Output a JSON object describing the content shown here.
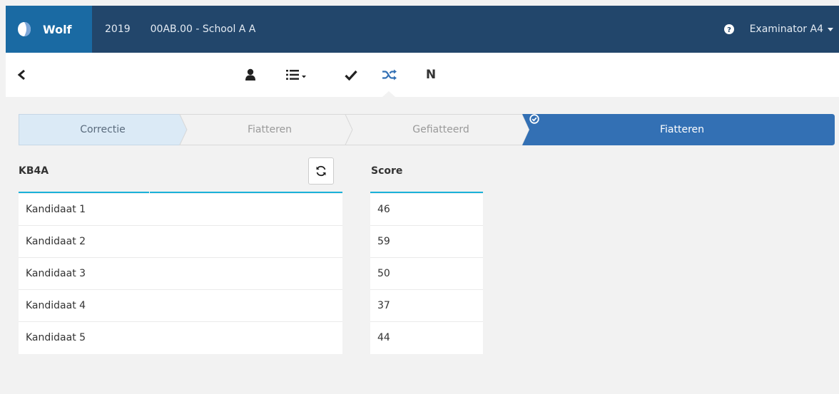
{
  "navbar": {
    "brand": "Wolf",
    "year": "2019",
    "school": "00AB.00 - School A A",
    "user": "Examinator A4"
  },
  "toolbar": {
    "icons": [
      "user-icon",
      "list-icon",
      "check-icon",
      "shuffle-icon"
    ],
    "n_label": "N",
    "active": "shuffle-icon"
  },
  "steps": [
    {
      "label": "Correctie",
      "state": "current"
    },
    {
      "label": "Fiatteren",
      "state": "inactive"
    },
    {
      "label": "Gefiatteerd",
      "state": "inactive"
    },
    {
      "label": "Fiatteren",
      "state": "action",
      "icon": "circle-check-icon"
    }
  ],
  "candidates": {
    "header": "KB4A",
    "rows": [
      "Kandidaat 1",
      "Kandidaat 2",
      "Kandidaat 3",
      "Kandidaat 4",
      "Kandidaat 5"
    ]
  },
  "scores": {
    "header": "Score",
    "rows": [
      "46",
      "59",
      "50",
      "37",
      "44"
    ]
  },
  "colors": {
    "navbar": "#22466b",
    "brand": "#1a6aa3",
    "step_current": "#dbeaf6",
    "step_action": "#3370b4",
    "accent_line": "#1ab1d9"
  }
}
